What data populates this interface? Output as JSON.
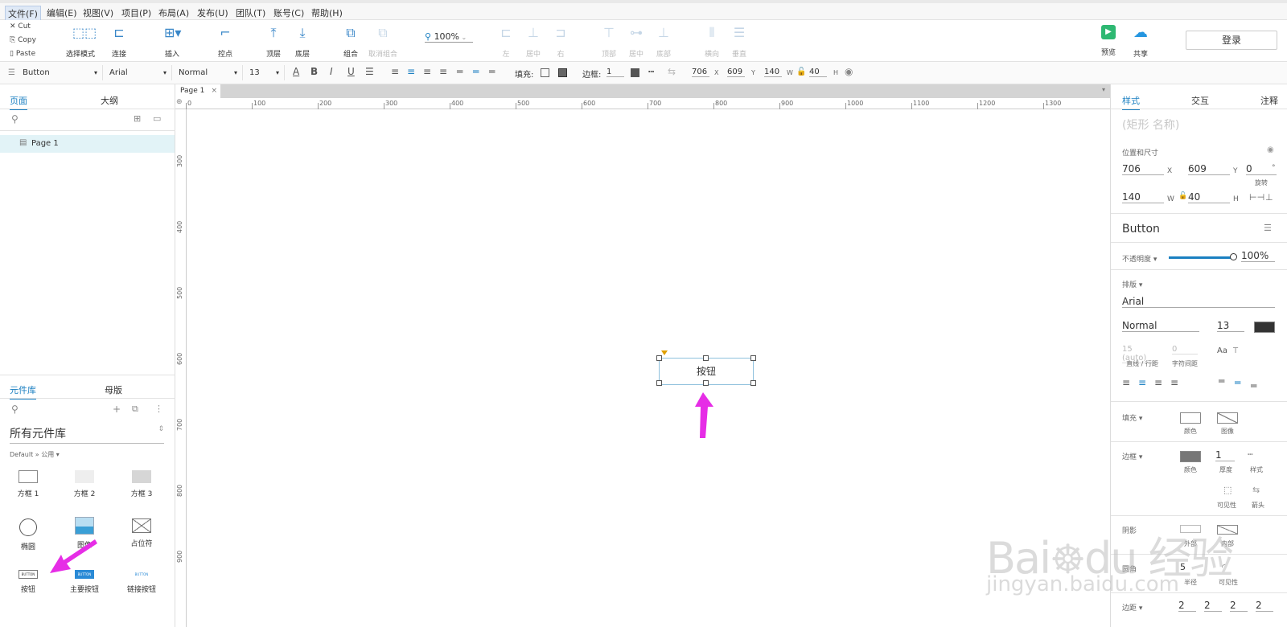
{
  "menu": [
    "文件(F)",
    "编辑(E)",
    "视图(V)",
    "项目(P)",
    "布局(A)",
    "发布(U)",
    "团队(T)",
    "账号(C)",
    "帮助(H)"
  ],
  "clipboard": {
    "cut": "Cut",
    "copy": "Copy",
    "paste": "Paste"
  },
  "toolbar": {
    "select_mode": "选择模式",
    "connect": "连接",
    "insert": "插入",
    "point": "控点",
    "top": "顶层",
    "bottom": "底层",
    "group": "组合",
    "ungroup": "取消组合",
    "zoom": "100%",
    "align_left": "左",
    "align_center": "居中",
    "align_right": "右",
    "align_top": "顶部",
    "align_middle": "居中",
    "align_bottom": "底部",
    "distribute_h": "横向",
    "distribute_v": "垂直",
    "preview": "预览",
    "share": "共享",
    "login": "登录"
  },
  "format": {
    "widget_type": "Button",
    "font": "Arial",
    "weight": "Normal",
    "size": "13",
    "fill_label": "填充:",
    "border_label": "边框:",
    "border_value": "1",
    "x": "706",
    "y": "609",
    "w": "140",
    "h": "40",
    "x_label": "X",
    "y_label": "Y",
    "w_label": "W",
    "h_label": "H"
  },
  "left": {
    "tab_pages": "页面",
    "tab_outline": "大纲",
    "page_item": "Page 1",
    "tab_library": "元件库",
    "tab_masters": "母版",
    "library_title": "所有元件库",
    "library_path": "Default » 公用 ▾",
    "widgets": [
      "方框 1",
      "方框 2",
      "方框 3",
      "椭圆",
      "图像",
      "占位符",
      "按钮",
      "主要按钮",
      "链接按钮"
    ],
    "btn_text": "BUTTON"
  },
  "canvas": {
    "page_tab": "Page 1",
    "ruler_h": [
      "0",
      "100",
      "200",
      "300",
      "400",
      "500",
      "600",
      "700",
      "800",
      "900",
      "1000",
      "1100",
      "1200",
      "1300"
    ],
    "ruler_v": [
      "300",
      "400",
      "500",
      "600",
      "700",
      "800",
      "900"
    ],
    "button_text": "按钮"
  },
  "right": {
    "tab_style": "样式",
    "tab_interact": "交互",
    "tab_notes": "注释",
    "shape_name_placeholder": "(矩形 名称)",
    "pos_size_label": "位置和尺寸",
    "x": "706",
    "y": "609",
    "rotation": "0",
    "rotation_unit": "°",
    "rotation_label": "旋转",
    "w": "140",
    "h": "40",
    "x_label": "X",
    "y_label": "Y",
    "w_label": "W",
    "h_label": "H",
    "widget_type": "Button",
    "opacity_label": "不透明度 ▾",
    "opacity": "100%",
    "typography_label": "排版 ▾",
    "font": "Arial",
    "weight": "Normal",
    "size": "13",
    "line_height": "15 (auto)",
    "char_spacing": "0",
    "line_height_label": "直线 / 行距",
    "char_spacing_label": "字符间距",
    "fill_label": "填充 ▾",
    "fill_color": "颜色",
    "fill_image": "图像",
    "border_label": "边框 ▾",
    "border_color": "颜色",
    "border_thickness": "1",
    "border_thick_label": "厚度",
    "border_style": "样式",
    "visibility": "可见性",
    "arrow": "箭头",
    "shadow_label": "阴影",
    "shadow_outer": "外部",
    "shadow_inner": "内部",
    "corner_label": "圆角",
    "corner_radius": "5",
    "radius_label": "半径",
    "corner_vis": "可见性",
    "padding_label": "边距 ▾",
    "padding": [
      "2",
      "2",
      "2",
      "2"
    ]
  },
  "watermark": {
    "logo": "Bai du 经验",
    "url": "jingyan.baidu.com"
  },
  "colors": {
    "accent": "#1a7fc1",
    "arrow": "#e62de6",
    "selection": "#8fc1dd"
  }
}
